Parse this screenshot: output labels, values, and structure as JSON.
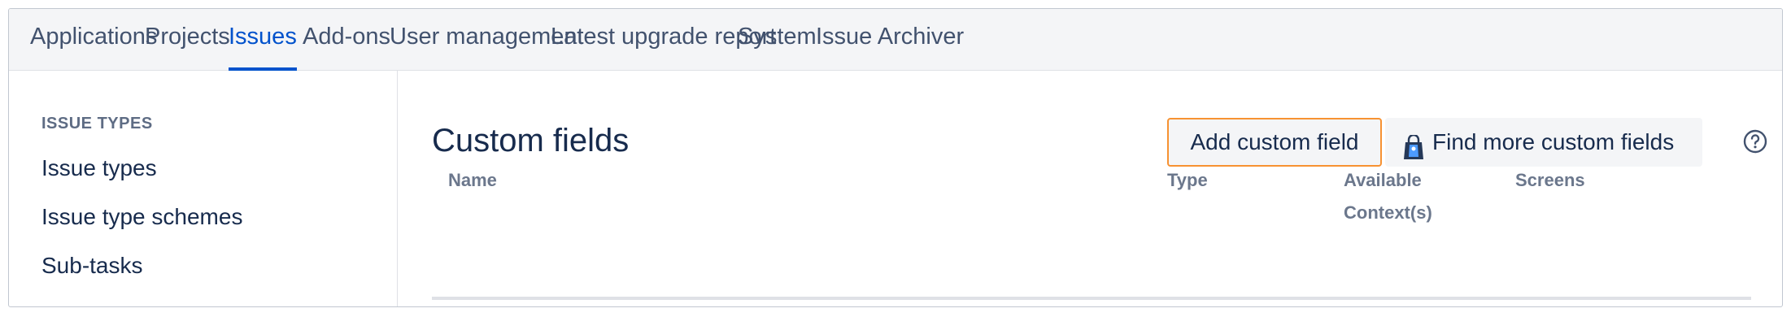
{
  "topnav": {
    "tabs": [
      {
        "label": "Applications",
        "active": false
      },
      {
        "label": "Projects",
        "active": false
      },
      {
        "label": "Issues",
        "active": true
      },
      {
        "label": "Add-ons",
        "active": false
      },
      {
        "label": "User management",
        "active": false
      },
      {
        "label": "Latest upgrade report",
        "active": false
      },
      {
        "label": "System",
        "active": false
      },
      {
        "label": "Issue Archiver",
        "active": false
      }
    ]
  },
  "sidebar": {
    "heading": "ISSUE TYPES",
    "links": [
      {
        "label": "Issue types"
      },
      {
        "label": "Issue type schemes"
      },
      {
        "label": "Sub-tasks"
      }
    ]
  },
  "main": {
    "title": "Custom fields",
    "add_button": "Add custom field",
    "find_button": "Find more custom fields",
    "help_icon": "question-circle-icon",
    "table": {
      "headers": [
        {
          "label": "Name"
        },
        {
          "label": "Type"
        },
        {
          "label": "Available\nContext(s)"
        },
        {
          "label": "Screens"
        }
      ]
    }
  },
  "colors": {
    "accent": "#0052cc",
    "focus_border": "#f79232",
    "nav_background": "#f4f5f7"
  }
}
